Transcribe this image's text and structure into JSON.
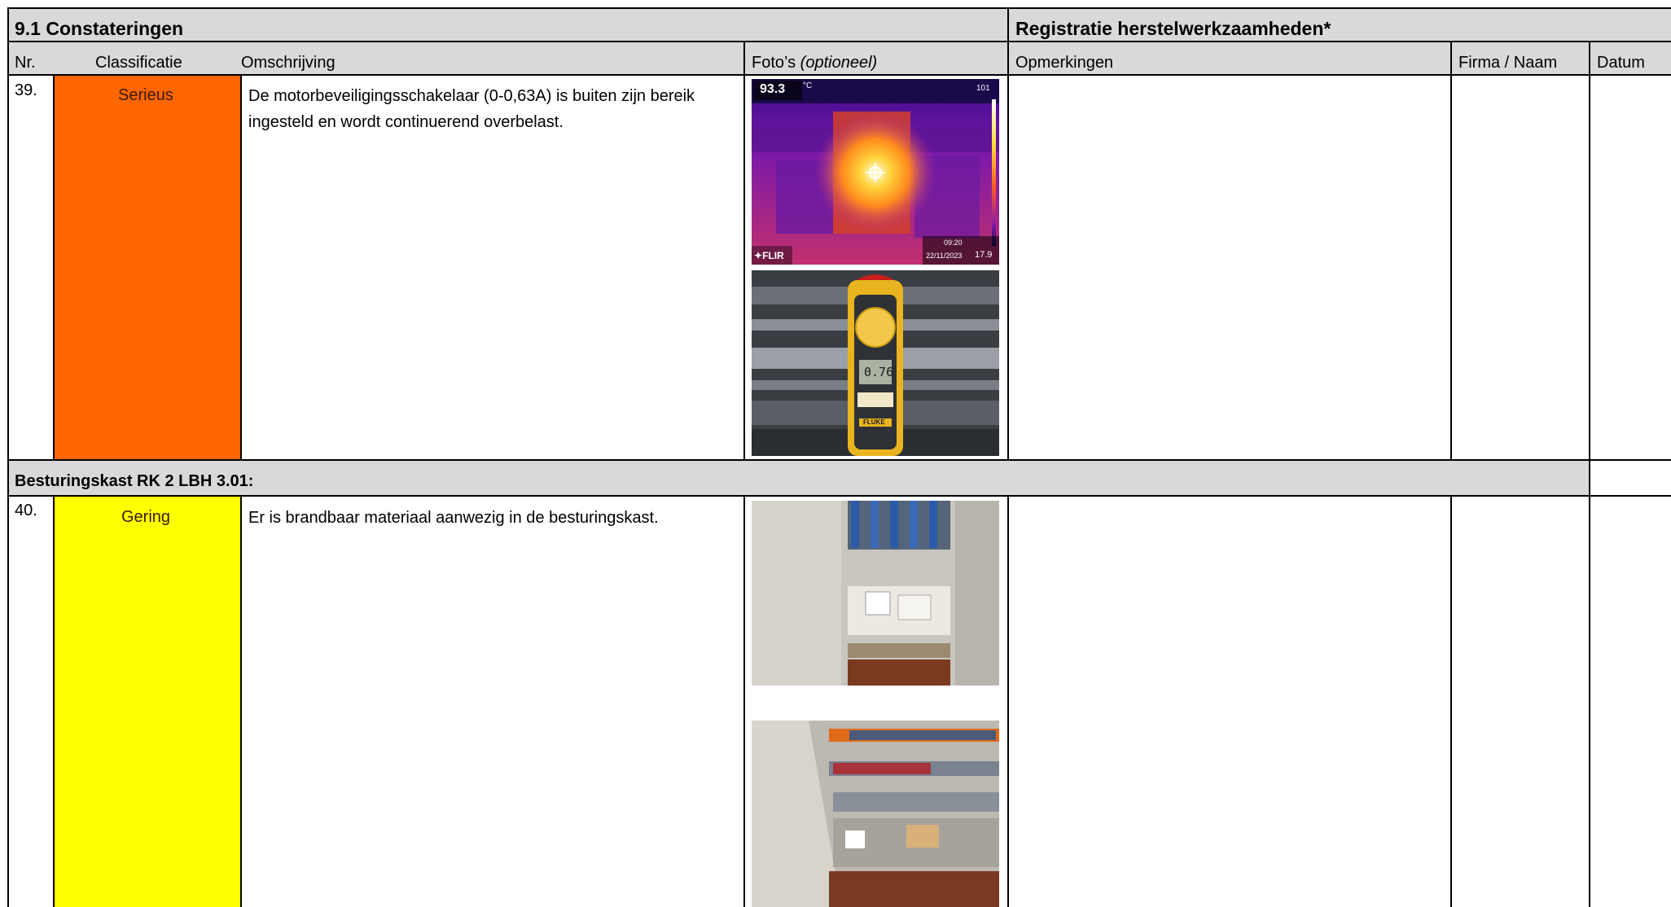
{
  "section": {
    "title": "9.1 Constateringen",
    "repair_title": "Registratie herstelwerkzaamheden*"
  },
  "columns": {
    "nr": "Nr.",
    "classificatie": "Classificatie",
    "omschrijving": "Omschrijving",
    "fotos": "Foto’s",
    "fotos_optional": "(optioneel)",
    "opmerkingen": "Opmerkingen",
    "firma": "Firma / Naam",
    "datum": "Datum"
  },
  "rows": [
    {
      "nr": "39.",
      "classification": "Serieus",
      "classification_color": "#ff6600",
      "description": "De motorbeveiligingsschakelaar (0-0,63A) is buiten zijn bereik ingesteld en wordt continuerend overbelast.",
      "photos": [
        {
          "kind": "thermal",
          "temp": "93.3",
          "unit": "°C",
          "scale_max": "101",
          "scale_min": "17.9",
          "time": "09:20",
          "date": "22/11/2023",
          "brand": "FLIR"
        },
        {
          "kind": "clamp-meter",
          "reading": "0.76",
          "brand": "FLUKE"
        }
      ]
    },
    {
      "nr": "40.",
      "classification": "Gering",
      "classification_color": "#ffff00",
      "description": "Er is brandbaar materiaal aanwezig in de besturingskast.",
      "photos": [
        {
          "kind": "cabinet-bottom"
        },
        {
          "kind": "cabinet-open"
        }
      ]
    }
  ],
  "group_header": "Besturingskast RK 2 LBH 3.01:"
}
